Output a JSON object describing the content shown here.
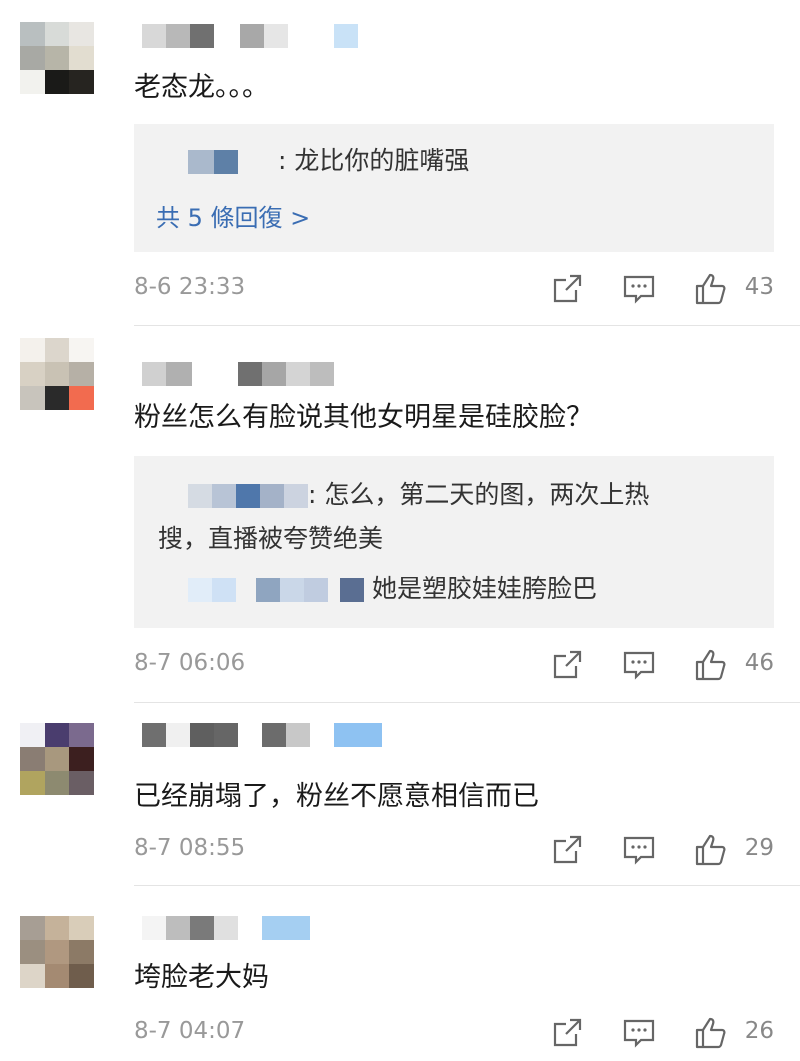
{
  "comments": [
    {
      "text": "老态龙。。。",
      "replies": [
        {
          "text": ": 龙比你的脏嘴强"
        }
      ],
      "more_link": "共 5 條回復 >",
      "time": "8-6 23:33",
      "likes": "43"
    },
    {
      "text": "粉丝怎么有脸说其他女明星是硅胶脸？",
      "replies": [
        {
          "text": ": 怎么，第二天的图，两次上热",
          "text2": "搜，直播被夸赞绝美"
        },
        {
          "text": "她是塑胶娃娃胯脸巴"
        }
      ],
      "time": "8-7 06:06",
      "likes": "46"
    },
    {
      "text": "已经崩塌了，粉丝不愿意相信而已",
      "time": "8-7 08:55",
      "likes": "29"
    },
    {
      "text": "垮脸老大妈",
      "time": "8-7 04:07",
      "likes": "26"
    }
  ],
  "icons": {
    "share": "share-icon",
    "comment": "comment-icon",
    "like": "thumbs-up-icon"
  },
  "colors": {
    "link": "#3a6db3",
    "reply_bg": "#f2f2f2",
    "meta_text": "#999999"
  }
}
